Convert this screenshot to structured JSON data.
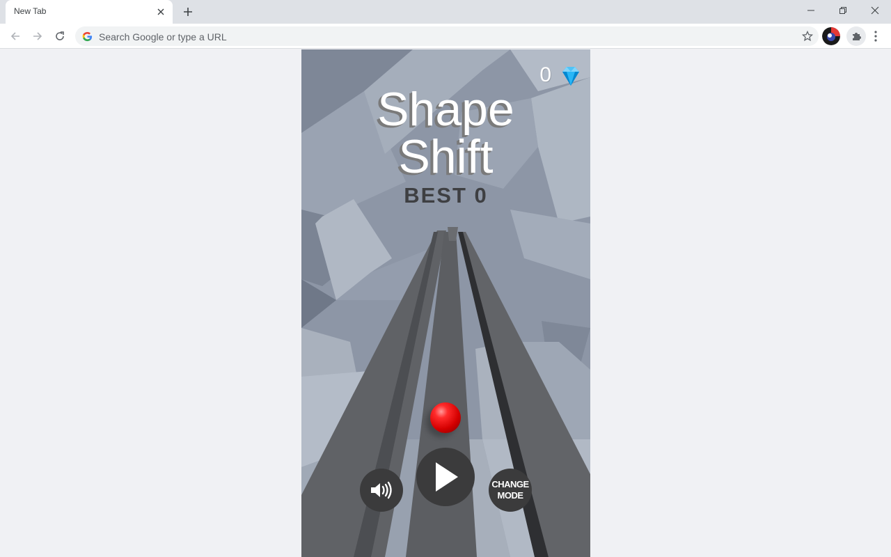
{
  "browser": {
    "tab_title": "New Tab",
    "omnibox_placeholder": "Search Google or type a URL"
  },
  "game": {
    "title_line1": "Shape",
    "title_line2": "Shift",
    "best_label": "BEST 0",
    "gem_count": "0",
    "change_mode_line1": "CHANGE",
    "change_mode_line2": "MODE",
    "icons": {
      "gem": "diamond-icon",
      "sound": "speaker-icon",
      "play": "play-icon"
    },
    "colors": {
      "title": "#ffffff",
      "best": "#3e3f42",
      "button_bg": "#3b3b3c",
      "ball": "#e00000",
      "gem": "#29b6f6"
    }
  }
}
